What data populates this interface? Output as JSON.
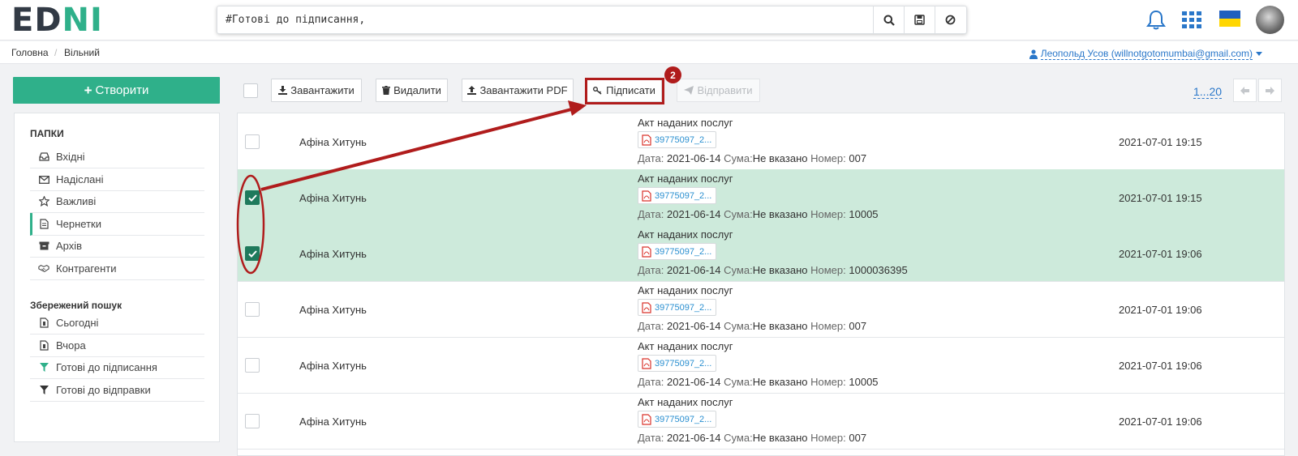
{
  "logo": {
    "part1": "ED",
    "part2": "NI"
  },
  "search": {
    "value": "#Готові до підписання,"
  },
  "breadcrumb": {
    "home": "Головна",
    "separator": "/",
    "current": "Вільний"
  },
  "user": {
    "label": "Леопольд Усов (willnotgotomumbai@gmail.com)"
  },
  "sidebar": {
    "create_label": "Створити",
    "folders_title": "ПАПКИ",
    "folders": [
      {
        "label": "Вхідні",
        "icon": "inbox-icon"
      },
      {
        "label": "Надіслані",
        "icon": "envelope-icon"
      },
      {
        "label": "Важливі",
        "icon": "star-icon"
      },
      {
        "label": "Чернетки",
        "icon": "document-icon"
      },
      {
        "label": "Архів",
        "icon": "archive-icon"
      },
      {
        "label": "Контрагенти",
        "icon": "handshake-icon"
      }
    ],
    "saved_title": "Збережений пошук",
    "saved": [
      {
        "label": "Сьогодні",
        "icon": "calendar-doc-icon"
      },
      {
        "label": "Вчора",
        "icon": "calendar-doc-icon"
      },
      {
        "label": "Готові до підписання",
        "icon": "filter-icon"
      },
      {
        "label": "Готові до відправки",
        "icon": "filter-icon"
      }
    ]
  },
  "toolbar": {
    "download": "Завантажити",
    "delete": "Видалити",
    "download_pdf": "Завантажити PDF",
    "sign": "Підписати",
    "send": "Відправити",
    "pager": "1...20"
  },
  "annotation": {
    "badge": "2"
  },
  "labels": {
    "date": "Дата:",
    "sum": "Сума:",
    "number": "Номер:"
  },
  "colors": {
    "accent": "#2fb08a",
    "selected_row": "#cdeadb",
    "annotation": "#b01c1c",
    "link": "#2a77c9"
  },
  "rows": [
    {
      "checked": false,
      "name": "Афіна Хитунь",
      "doctype": "Акт наданих послуг",
      "file": "39775097_2...",
      "doc_date": "2021-06-14",
      "sum": "Не вказано",
      "number": "007",
      "datetime": "2021-07-01 19:15"
    },
    {
      "checked": true,
      "name": "Афіна Хитунь",
      "doctype": "Акт наданих послуг",
      "file": "39775097_2...",
      "doc_date": "2021-06-14",
      "sum": "Не вказано",
      "number": "10005",
      "datetime": "2021-07-01 19:15"
    },
    {
      "checked": true,
      "name": "Афіна Хитунь",
      "doctype": "Акт наданих послуг",
      "file": "39775097_2...",
      "doc_date": "2021-06-14",
      "sum": "Не вказано",
      "number": "1000036395",
      "datetime": "2021-07-01 19:06"
    },
    {
      "checked": false,
      "name": "Афіна Хитунь",
      "doctype": "Акт наданих послуг",
      "file": "39775097_2...",
      "doc_date": "2021-06-14",
      "sum": "Не вказано",
      "number": "007",
      "datetime": "2021-07-01 19:06"
    },
    {
      "checked": false,
      "name": "Афіна Хитунь",
      "doctype": "Акт наданих послуг",
      "file": "39775097_2...",
      "doc_date": "2021-06-14",
      "sum": "Не вказано",
      "number": "10005",
      "datetime": "2021-07-01 19:06"
    },
    {
      "checked": false,
      "name": "Афіна Хитунь",
      "doctype": "Акт наданих послуг",
      "file": "39775097_2...",
      "doc_date": "2021-06-14",
      "sum": "Не вказано",
      "number": "007",
      "datetime": "2021-07-01 19:06"
    }
  ]
}
